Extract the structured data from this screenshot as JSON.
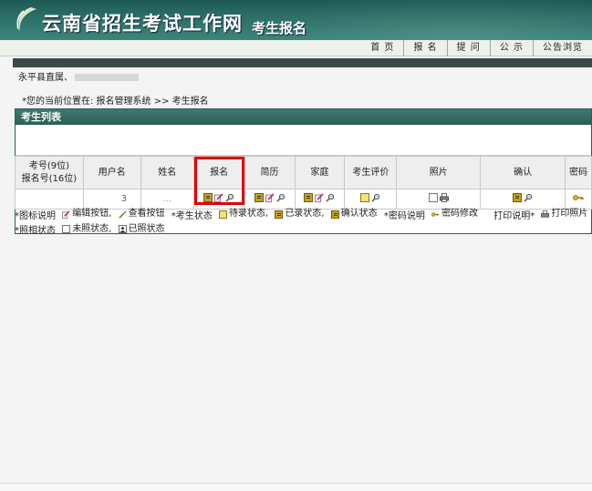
{
  "header": {
    "site_title": "云南省招生考试工作网",
    "sub_title": "考生报名"
  },
  "nav": {
    "items": [
      "首 页",
      "报 名",
      "提 问",
      "公 示",
      "公告浏览"
    ]
  },
  "area_name": "永平县直属、",
  "breadcrumb": "*您的当前位置在: 报名管理系统 >> 考生报名",
  "panel": {
    "title": "考生列表",
    "columns": [
      "考号(9位)\n报名号(16位)",
      "用户名",
      "姓名",
      "报名",
      "简历",
      "家庭",
      "考生评价",
      "照片",
      "确认",
      "密码"
    ],
    "row": {
      "exam_no": "",
      "username": "3",
      "name": "..."
    }
  },
  "legend": {
    "row1": [
      {
        "label": "*图标说明",
        "icon": ""
      },
      {
        "label": "编辑按钮,",
        "icon": "edit-icon"
      },
      {
        "label": "查看按钮",
        "icon": "view-icon"
      },
      {
        "label": "*考生状态",
        "icon": ""
      },
      {
        "label": "待录状态,",
        "icon": "pending-icon"
      },
      {
        "label": "已录状态,",
        "icon": "entered-icon"
      },
      {
        "label": "确认状态",
        "icon": "confirmed-icon"
      },
      {
        "label": "*密码说明",
        "icon": ""
      },
      {
        "label": "密码修改",
        "icon": "key-icon"
      },
      {
        "label": "打印说明*",
        "icon": ""
      },
      {
        "label": "打印照片",
        "icon": "printer-icon"
      }
    ],
    "row2": [
      {
        "label": "*照相状态",
        "icon": ""
      },
      {
        "label": "未照状态,",
        "icon": "no-photo-icon"
      },
      {
        "label": "已照状态",
        "icon": "photo-icon"
      }
    ]
  },
  "colors": {
    "header_dark": "#1e5a55",
    "panel_head": "#2b5f56",
    "highlight": "#e10000"
  }
}
